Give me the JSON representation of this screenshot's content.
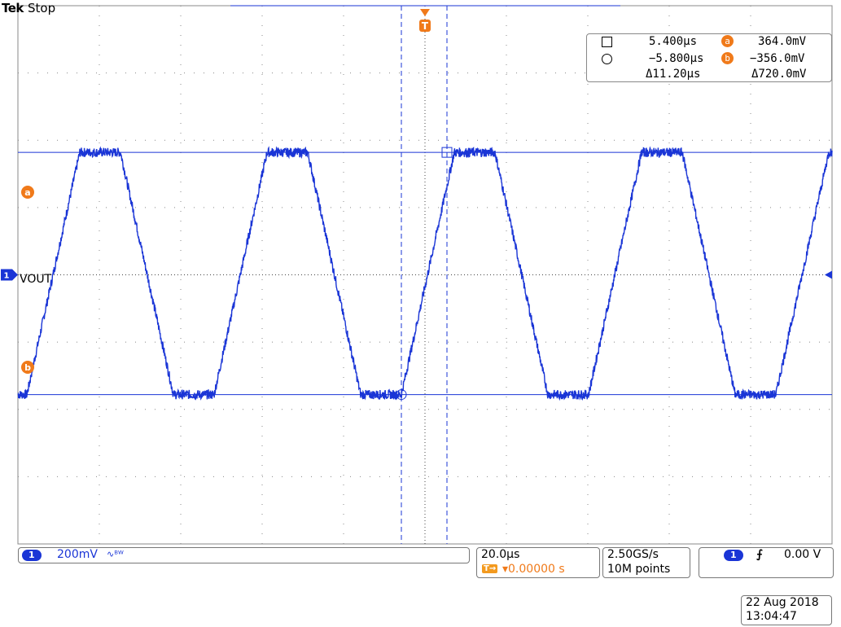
{
  "header": {
    "brand": "Tek",
    "status": "Stop"
  },
  "channel": {
    "number": "1",
    "label": "VOUT",
    "scale": "200mV",
    "coupling_glyph": "∿ᴮᵂ"
  },
  "cursor_readout": {
    "time_a": "5.400µs",
    "time_b": "−5.800µs",
    "time_delta": "Δ11.20µs",
    "volt_a_marker": "a",
    "volt_a": "364.0mV",
    "volt_b_marker": "b",
    "volt_b": "−356.0mV",
    "volt_delta": "Δ720.0mV"
  },
  "timebase": {
    "scale": "20.0µs",
    "position": "▾0.00000 s",
    "trigger_tag": "T→"
  },
  "acquisition": {
    "rate": "2.50GS/s",
    "length": "10M points"
  },
  "trigger": {
    "source": "1",
    "slope_glyph": "⨍",
    "level": "0.00 V"
  },
  "markers": {
    "trigger": "T",
    "cursor_a": "a",
    "cursor_b": "b",
    "ch_tag": "1"
  },
  "datetime": {
    "date": "22 Aug 2018",
    "time": "13:04:47"
  },
  "waveform": {
    "period_us": 46.0,
    "high_mv": 364,
    "low_mv": -356,
    "volts_per_div_mv": 200,
    "time_per_div_us": 20,
    "color": "#1a35d6",
    "cursor_color": "#1a35d6",
    "accent": "#f07a1a"
  }
}
